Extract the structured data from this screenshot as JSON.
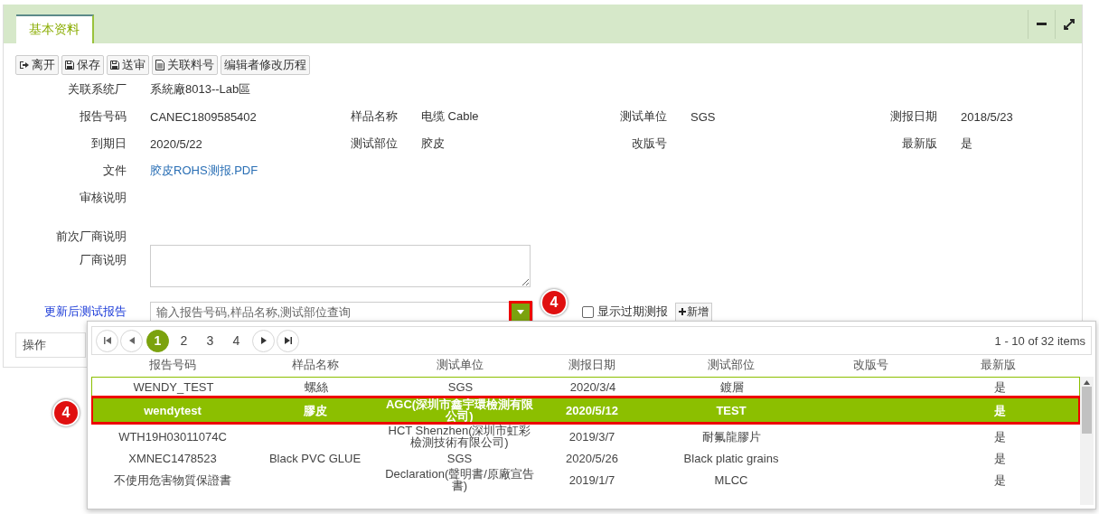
{
  "tab": {
    "label": "基本资料",
    "selected": true
  },
  "toolbar": [
    {
      "kind": "exit",
      "label": "离开"
    },
    {
      "kind": "save",
      "label": "保存"
    },
    {
      "kind": "save",
      "label": "送审"
    },
    {
      "kind": "document",
      "label": "关联料号"
    },
    {
      "kind": "plain",
      "label": "编辑者修改历程"
    }
  ],
  "form_rows": [
    [
      {
        "kind": "text",
        "label": "关联系统厂",
        "value": "系統廠8013--Lab區"
      }
    ],
    [
      {
        "kind": "text",
        "label": "报告号码",
        "value": "CANEC1809585402"
      },
      {
        "kind": "text",
        "label": "样品名称",
        "value": "电缆 Cable"
      },
      {
        "kind": "text",
        "label": "测试单位",
        "value": "SGS"
      },
      {
        "kind": "text",
        "label": "测报日期",
        "value": "2018/5/23"
      }
    ],
    [
      {
        "kind": "text",
        "label": "到期日",
        "value": "2020/5/22"
      },
      {
        "kind": "text",
        "label": "测试部位",
        "value": "胶皮"
      },
      {
        "kind": "text",
        "label": "改版号"
      },
      {
        "kind": "text",
        "label": "最新版",
        "value": "是"
      }
    ],
    [
      {
        "kind": "link",
        "label": "文件",
        "value": "胶皮ROHS测报.PDF"
      }
    ],
    [
      {
        "kind": "text",
        "label": "审核说明"
      }
    ],
    [
      {
        "kind": "text",
        "label": "前次厂商说明"
      }
    ],
    [
      {
        "kind": "textarea",
        "label": "厂商说明"
      }
    ]
  ],
  "report_lookup": {
    "label": "更新后测试报告",
    "placeholder": "输入报告号码,样品名称,测试部位查询",
    "show_expired": {
      "label": "显示过期测报",
      "checked": false
    },
    "add_button": "新增"
  },
  "operation_field": {
    "label": "操作"
  },
  "dropdown": {
    "pager": {
      "pages": [
        {
          "label": "1",
          "selected": true
        },
        {
          "label": "2",
          "selected": false
        },
        {
          "label": "3",
          "selected": false
        },
        {
          "label": "4",
          "selected": false
        }
      ],
      "summary": "1 - 10 of 32 items"
    },
    "columns": [
      "报告号码",
      "样品名称",
      "测试单位",
      "测报日期",
      "测试部位",
      "改版号",
      "最新版"
    ],
    "rows": [
      {
        "report_no": "WENDY_TEST",
        "sample_name": "螺絲",
        "test_unit": "SGS",
        "report_date": "2020/3/4",
        "test_part": "鍍層",
        "latest": "是",
        "selected": false
      },
      {
        "report_no": "wendytest",
        "sample_name": "膠皮",
        "test_unit": "AGC(深圳市鑫宇環檢測有限公司)",
        "report_date": "2020/5/12",
        "test_part": "TEST",
        "latest": "是",
        "selected": true
      },
      {
        "report_no": "WTH19H03011074C",
        "test_unit": "HCT Shenzhen(深圳市虹彩檢測技術有限公司)",
        "report_date": "2019/3/7",
        "test_part": "耐氟龍膠片",
        "latest": "是",
        "selected": false
      },
      {
        "report_no": "XMNEC1478523",
        "sample_name": "Black PVC GLUE",
        "test_unit": "SGS",
        "report_date": "2020/5/26",
        "test_part": "Black platic grains",
        "latest": "是",
        "selected": false
      },
      {
        "report_no": "不使用危害物質保證書",
        "test_unit": "Declaration(聲明書/原廠宣告書)",
        "report_date": "2019/1/7",
        "test_part": "MLCC",
        "latest": "是",
        "selected": false
      }
    ]
  },
  "callouts": [
    "4",
    "4"
  ]
}
